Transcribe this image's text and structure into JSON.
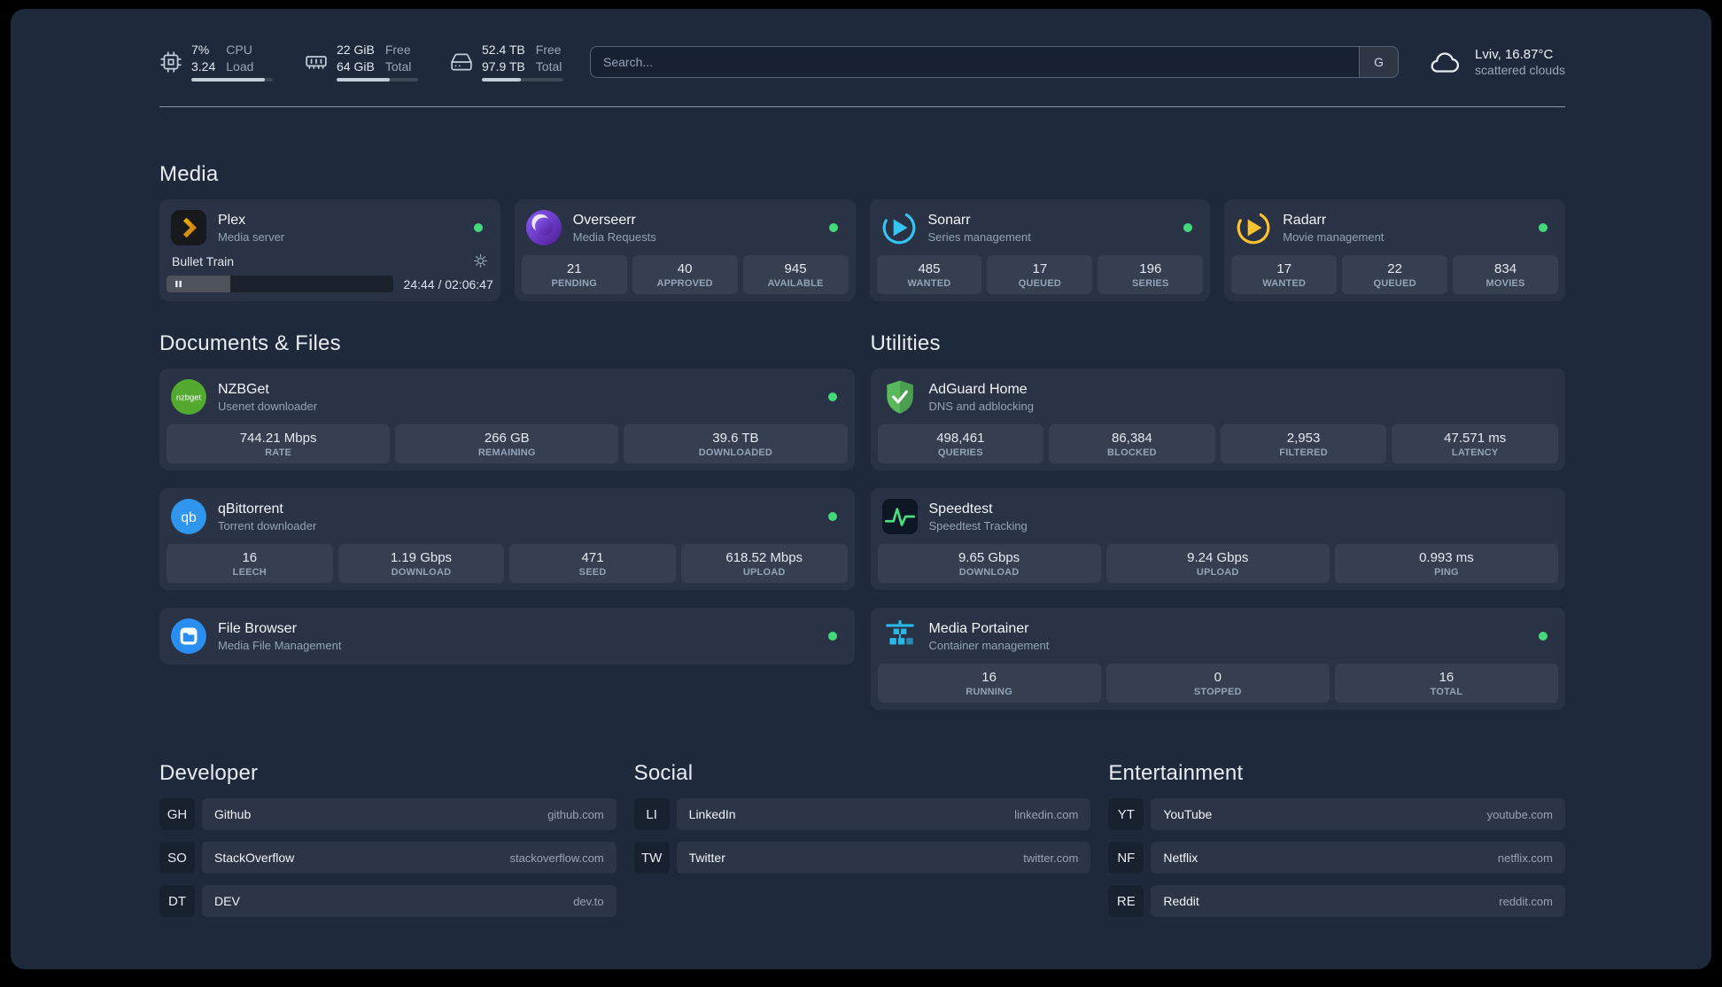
{
  "topbar": {
    "resources": {
      "cpu": {
        "value_top": "7%",
        "value_bottom": "3.24",
        "label_top": "CPU",
        "label_bottom": "Load",
        "progress_percent": 90
      },
      "memory": {
        "value_top": "22 GiB",
        "value_bottom": "64 GiB",
        "label_top": "Free",
        "label_bottom": "Total",
        "progress_percent": 65
      },
      "disk": {
        "value_top": "52.4 TB",
        "value_bottom": "97.9 TB",
        "label_top": "Free",
        "label_bottom": "Total",
        "progress_percent": 48
      }
    },
    "search": {
      "placeholder": "Search...",
      "provider_button": "G"
    },
    "weather": {
      "location": "Lviv, 16.87°C",
      "condition": "scattered clouds"
    }
  },
  "sections": {
    "media": {
      "title": "Media",
      "plex": {
        "name": "Plex",
        "description": "Media server",
        "status": "online",
        "now_playing": "Bullet Train",
        "time_display": "24:44 / 02:06:47",
        "progress_percent": 20
      },
      "overseerr": {
        "name": "Overseerr",
        "description": "Media Requests",
        "status": "online",
        "stats": [
          {
            "value": "21",
            "label": "PENDING"
          },
          {
            "value": "40",
            "label": "APPROVED"
          },
          {
            "value": "945",
            "label": "AVAILABLE"
          }
        ]
      },
      "sonarr": {
        "name": "Sonarr",
        "description": "Series management",
        "status": "online",
        "stats": [
          {
            "value": "485",
            "label": "WANTED"
          },
          {
            "value": "17",
            "label": "QUEUED"
          },
          {
            "value": "196",
            "label": "SERIES"
          }
        ]
      },
      "radarr": {
        "name": "Radarr",
        "description": "Movie management",
        "status": "online",
        "stats": [
          {
            "value": "17",
            "label": "WANTED"
          },
          {
            "value": "22",
            "label": "QUEUED"
          },
          {
            "value": "834",
            "label": "MOVIES"
          }
        ]
      }
    },
    "documents": {
      "title": "Documents & Files",
      "nzbget": {
        "name": "NZBGet",
        "description": "Usenet downloader",
        "status": "online",
        "stats": [
          {
            "value": "744.21 Mbps",
            "label": "RATE"
          },
          {
            "value": "266 GB",
            "label": "REMAINING"
          },
          {
            "value": "39.6 TB",
            "label": "DOWNLOADED"
          }
        ]
      },
      "qbittorrent": {
        "name": "qBittorrent",
        "description": "Torrent downloader",
        "status": "online",
        "stats": [
          {
            "value": "16",
            "label": "LEECH"
          },
          {
            "value": "1.19 Gbps",
            "label": "DOWNLOAD"
          },
          {
            "value": "471",
            "label": "SEED"
          },
          {
            "value": "618.52 Mbps",
            "label": "UPLOAD"
          }
        ]
      },
      "filebrowser": {
        "name": "File Browser",
        "description": "Media File Management",
        "status": "online"
      }
    },
    "utilities": {
      "title": "Utilities",
      "adguard": {
        "name": "AdGuard Home",
        "description": "DNS and adblocking",
        "stats": [
          {
            "value": "498,461",
            "label": "QUERIES"
          },
          {
            "value": "86,384",
            "label": "BLOCKED"
          },
          {
            "value": "2,953",
            "label": "FILTERED"
          },
          {
            "value": "47.571 ms",
            "label": "LATENCY"
          }
        ]
      },
      "speedtest": {
        "name": "Speedtest",
        "description": "Speedtest Tracking",
        "stats": [
          {
            "value": "9.65 Gbps",
            "label": "DOWNLOAD"
          },
          {
            "value": "9.24 Gbps",
            "label": "UPLOAD"
          },
          {
            "value": "0.993 ms",
            "label": "PING"
          }
        ]
      },
      "portainer": {
        "name": "Media Portainer",
        "description": "Container management",
        "status": "online",
        "stats": [
          {
            "value": "16",
            "label": "RUNNING"
          },
          {
            "value": "0",
            "label": "STOPPED"
          },
          {
            "value": "16",
            "label": "TOTAL"
          }
        ]
      }
    }
  },
  "bookmarks": {
    "developer": {
      "title": "Developer",
      "items": [
        {
          "abbr": "GH",
          "name": "Github",
          "url": "github.com"
        },
        {
          "abbr": "SO",
          "name": "StackOverflow",
          "url": "stackoverflow.com"
        },
        {
          "abbr": "DT",
          "name": "DEV",
          "url": "dev.to"
        }
      ]
    },
    "social": {
      "title": "Social",
      "items": [
        {
          "abbr": "LI",
          "name": "LinkedIn",
          "url": "linkedin.com"
        },
        {
          "abbr": "TW",
          "name": "Twitter",
          "url": "twitter.com"
        }
      ]
    },
    "entertainment": {
      "title": "Entertainment",
      "items": [
        {
          "abbr": "YT",
          "name": "YouTube",
          "url": "youtube.com"
        },
        {
          "abbr": "NF",
          "name": "Netflix",
          "url": "netflix.com"
        },
        {
          "abbr": "RE",
          "name": "Reddit",
          "url": "reddit.com"
        }
      ]
    }
  },
  "colors": {
    "page_background": "#1e293b",
    "status_online": "#43d97a",
    "plex_accent": "#e5a00d",
    "overseerr_accent": "#6d28d9",
    "sonarr_accent": "#35c5f4",
    "radarr_accent": "#ffc230",
    "nzbget_accent": "#54a931",
    "qbittorrent_accent": "#3095ec",
    "adguard_accent": "#59b85c",
    "speedtest_accent": "#4ade80",
    "portainer_accent": "#29b8ea"
  }
}
